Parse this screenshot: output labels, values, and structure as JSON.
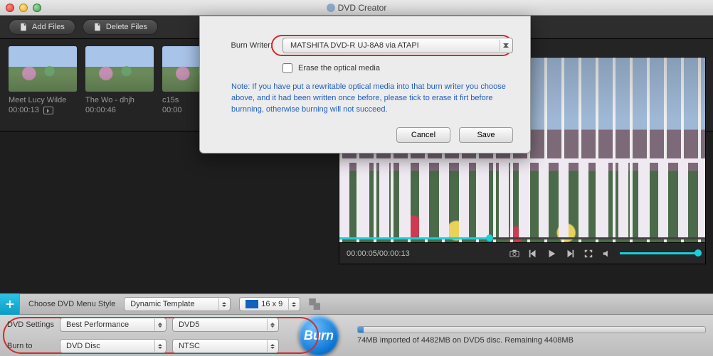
{
  "window": {
    "title": "DVD Creator"
  },
  "toolbar": {
    "add_label": "Add Files",
    "delete_label": "Delete Files"
  },
  "clips": [
    {
      "name": "Meet Lucy Wilde",
      "duration": "00:00:13",
      "selected": true,
      "has_export": true
    },
    {
      "name": "The Wo - dhjh",
      "duration": "00:00:46",
      "selected": false,
      "has_export": false
    },
    {
      "name": "c15s",
      "duration": "00:00",
      "selected": false,
      "has_export": false
    }
  ],
  "player": {
    "time_current": "00:00:05",
    "time_total": "00:00:13"
  },
  "menubar": {
    "choose_label": "Choose DVD Menu Style",
    "template": "Dynamic Template",
    "ratio": "16 x 9"
  },
  "settings": {
    "settings_label": "DVD Settings",
    "burnto_label": "Burn to",
    "quality": "Best Performance",
    "disc_type": "DVD5",
    "target": "DVD Disc",
    "standard": "NTSC"
  },
  "burn": {
    "button": "Burn",
    "status": "74MB imported of 4482MB on DVD5 disc. Remaining 4408MB"
  },
  "modal": {
    "writer_label": "Burn Writer:",
    "writer_value": "MATSHITA DVD-R   UJ-8A8 via ATAPI",
    "erase_label": "Erase the optical media",
    "note": "Note: If you have put a rewritable optical media into that burn writer you choose above, and it had been written once before, please tick to erase it firt before burnning, otherwise burning will not succeed.",
    "cancel": "Cancel",
    "save": "Save"
  }
}
